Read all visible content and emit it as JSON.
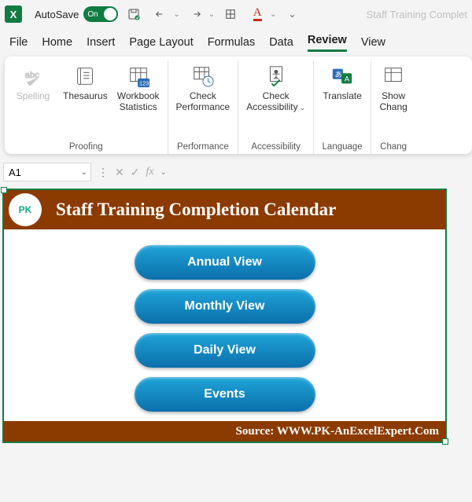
{
  "titlebar": {
    "autosave_label": "AutoSave",
    "autosave_state": "On",
    "doc_title": "Staff Training Complet"
  },
  "tabs": {
    "file": "File",
    "home": "Home",
    "insert": "Insert",
    "page_layout": "Page Layout",
    "formulas": "Formulas",
    "data": "Data",
    "review": "Review",
    "view": "View"
  },
  "ribbon": {
    "proofing": {
      "spelling": "Spelling",
      "thesaurus": "Thesaurus",
      "workbook_stats": "Workbook\nStatistics",
      "group": "Proofing"
    },
    "performance": {
      "check_perf": "Check\nPerformance",
      "group": "Performance"
    },
    "accessibility": {
      "check_access": "Check\nAccessibility",
      "group": "Accessibility"
    },
    "language": {
      "translate": "Translate",
      "group": "Language"
    },
    "changes": {
      "show_changes": "Show\nChang",
      "group": "Chang"
    }
  },
  "formula_bar": {
    "name_box": "A1",
    "fx": "fx"
  },
  "sheet": {
    "header_title": "Staff Training Completion Calendar",
    "buttons": {
      "annual": "Annual View",
      "monthly": "Monthly View",
      "daily": "Daily View",
      "events": "Events"
    },
    "footer": "Source: WWW.PK-AnExcelExpert.Com"
  }
}
